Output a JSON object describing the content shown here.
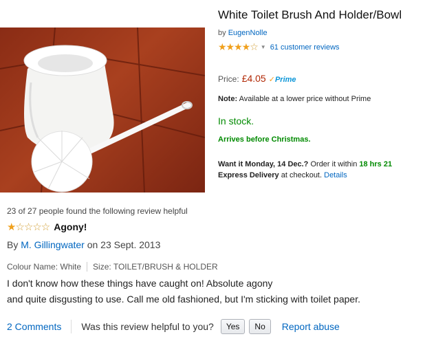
{
  "product": {
    "title": "White Toilet Brush And Holder/Bowl",
    "by": "by",
    "brand": "EugenNolle",
    "reviews_link": "61 customer reviews",
    "price_label": "Price:",
    "price": "£4.05",
    "prime": "Prime",
    "note_label": "Note:",
    "note_text": "Available at a lower price without Prime",
    "stock": "In stock.",
    "arrives": "Arrives before Christmas.",
    "want_bold": "Want it Monday, 14 Dec.?",
    "want_order": "Order it within",
    "want_time": "18 hrs 21",
    "want_express": "Express Delivery",
    "want_checkout": "at checkout.",
    "details_link": "Details"
  },
  "review": {
    "helpful_count": "23 of 27 people found the following review helpful",
    "title": "Agony!",
    "by": "By",
    "author": "M. Gillingwater",
    "date": "on 23 Sept. 2013",
    "colour": "Colour Name: White",
    "size": "Size: TOILET/BRUSH & HOLDER",
    "line1": "I don't know how these things have caught on! Absolute agony",
    "line2": "and quite disgusting to use. Call me old fashioned, but I'm sticking with toilet paper.",
    "comments": "2 Comments",
    "helpful_question": "Was this review helpful to you?",
    "yes": "Yes",
    "no": "No",
    "report": "Report abuse"
  }
}
